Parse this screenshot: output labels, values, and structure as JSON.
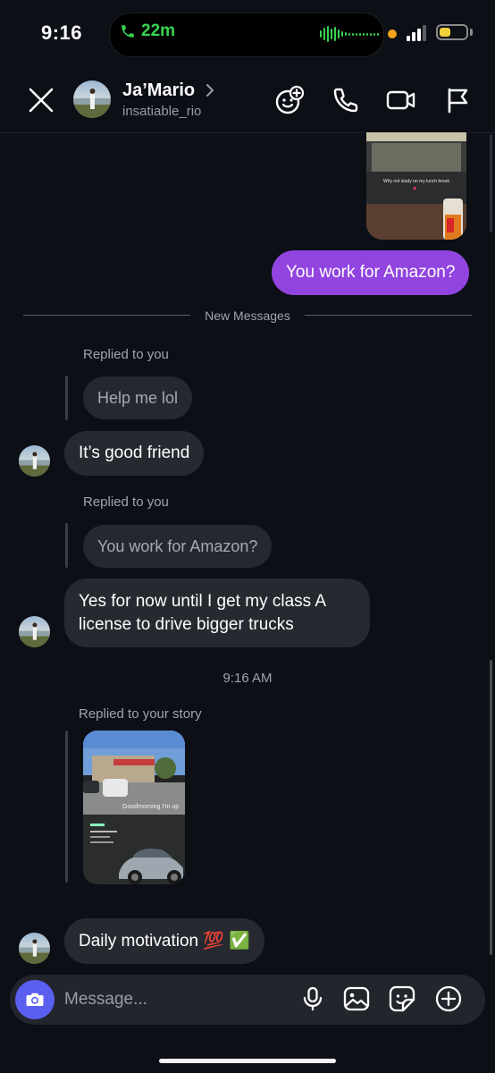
{
  "status_bar": {
    "time": "9:16",
    "call_duration": "22m"
  },
  "header": {
    "name": "Ja’Mario",
    "username": "insatiable_rio"
  },
  "messages": {
    "outgoing": "You work for Amazon?",
    "photo_caption": "Why not study on my lunch break",
    "new_messages_label": "New Messages",
    "reply1_label": "Replied to you",
    "reply1_quote": "Help me lol",
    "reply1_text": "It’s good friend",
    "reply2_label": "Replied to you",
    "reply2_quote": "You work for Amazon?",
    "reply2_text": "Yes for now until I get my class A license to drive bigger trucks",
    "timestamp": "9:16 AM",
    "story_label": "Replied to your story",
    "story_caption": "Goodmorning I'm up",
    "last_text": "Daily motivation 💯 ✅"
  },
  "composer": {
    "placeholder": "Message..."
  },
  "icons": {
    "close": "close-icon",
    "chevron": "chevron-right-icon",
    "effects": "face-effects-icon",
    "call": "phone-icon",
    "video": "video-camera-icon",
    "report": "flag-icon",
    "camera": "camera-icon",
    "mic": "microphone-icon",
    "gallery": "image-icon",
    "sticker": "sticker-icon",
    "plus": "plus-circle-icon"
  },
  "colors": {
    "background": "#0c0f16",
    "outgoing_bubble": "#9144e0",
    "incoming_bubble": "#262930",
    "camera_button": "#5b5ff0",
    "call_green": "#39d354"
  }
}
